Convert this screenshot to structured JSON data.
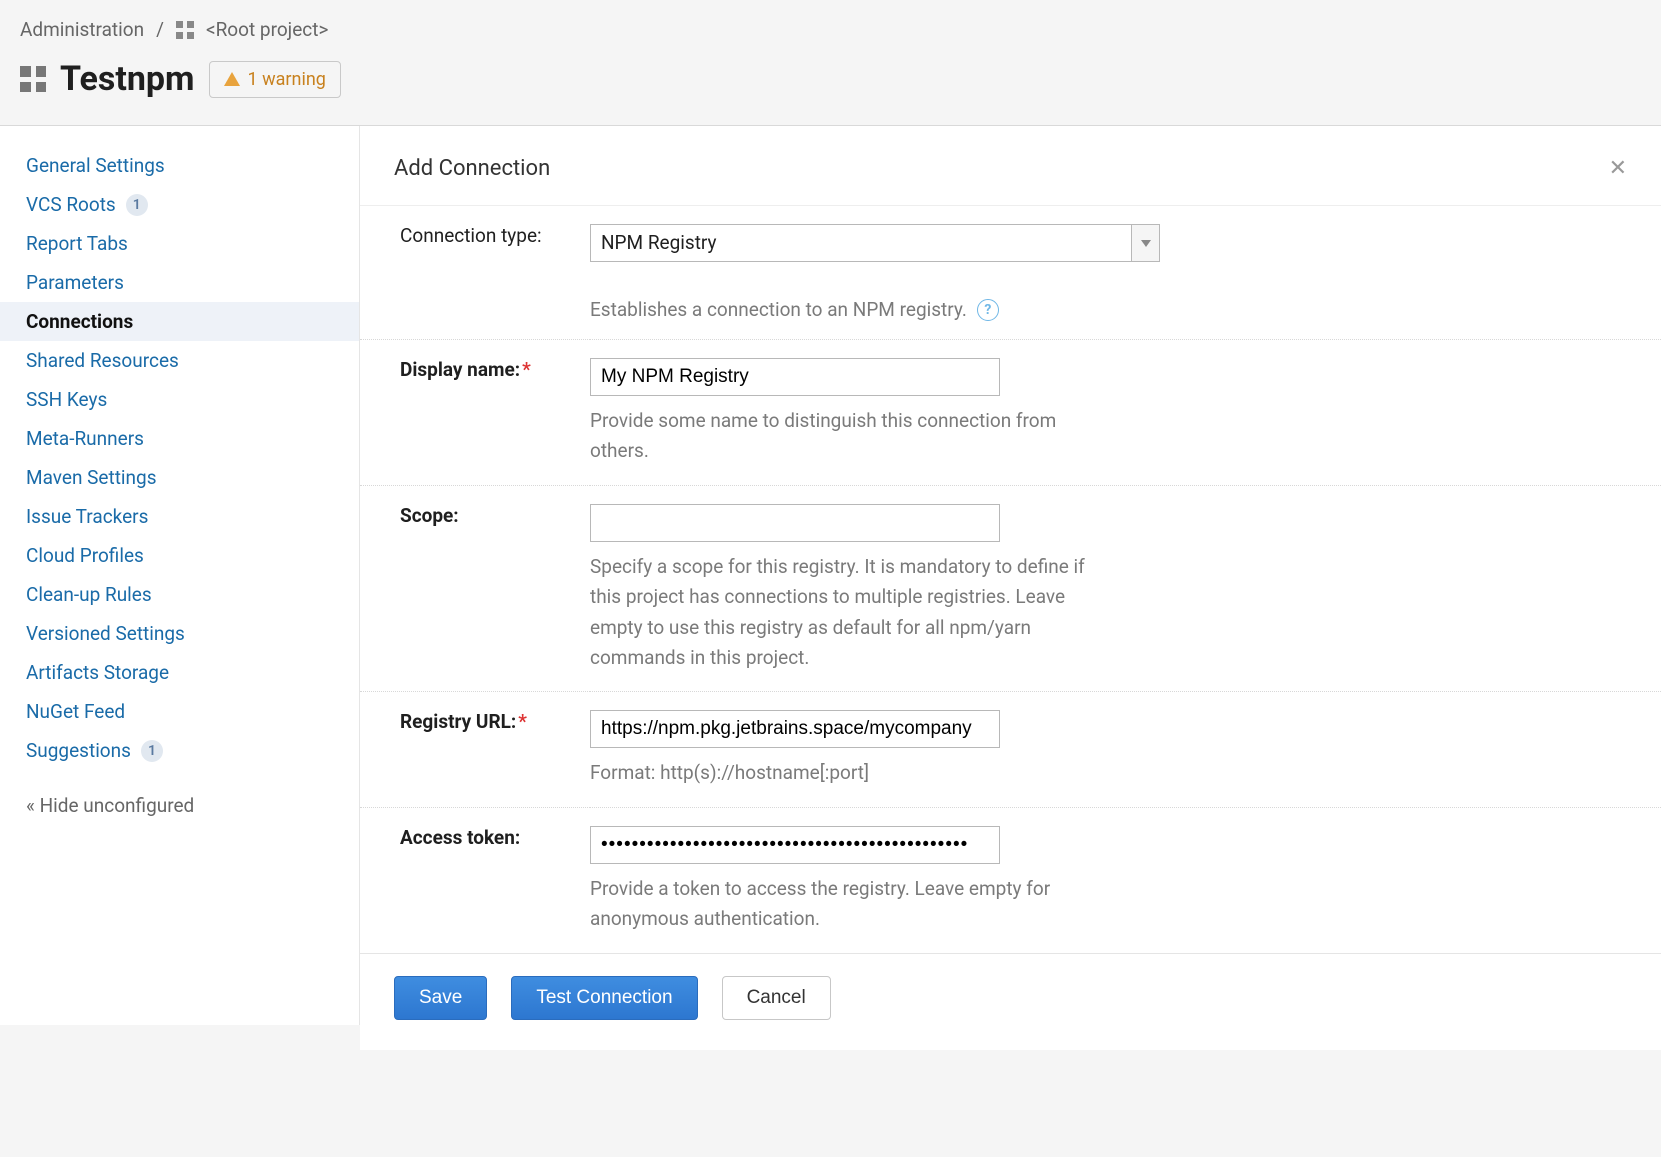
{
  "breadcrumb": {
    "admin": "Administration",
    "sep": "/",
    "root": "<Root project>"
  },
  "header": {
    "title": "Testnpm",
    "warning": "1 warning"
  },
  "sidebar": {
    "items": [
      {
        "label": "General Settings"
      },
      {
        "label": "VCS Roots",
        "badge": "1"
      },
      {
        "label": "Report Tabs"
      },
      {
        "label": "Parameters"
      },
      {
        "label": "Connections",
        "active": true
      },
      {
        "label": "Shared Resources"
      },
      {
        "label": "SSH Keys"
      },
      {
        "label": "Meta-Runners"
      },
      {
        "label": "Maven Settings"
      },
      {
        "label": "Issue Trackers"
      },
      {
        "label": "Cloud Profiles"
      },
      {
        "label": "Clean-up Rules"
      },
      {
        "label": "Versioned Settings"
      },
      {
        "label": "Artifacts Storage"
      },
      {
        "label": "NuGet Feed"
      },
      {
        "label": "Suggestions",
        "badge": "1"
      }
    ],
    "hide": "« Hide unconfigured"
  },
  "panel": {
    "title": "Add Connection",
    "fields": {
      "connection_type": {
        "label": "Connection type:",
        "value": "NPM Registry",
        "desc": "Establishes a connection to an NPM registry."
      },
      "display_name": {
        "label": "Display name:",
        "value": "My NPM Registry",
        "hint": "Provide some name to distinguish this connection from others."
      },
      "scope": {
        "label": "Scope:",
        "value": "",
        "hint": "Specify a scope for this registry. It is mandatory to define if this project has connections to multiple registries. Leave empty to use this registry as default for all npm/yarn commands in this project."
      },
      "registry_url": {
        "label": "Registry URL:",
        "value": "https://npm.pkg.jetbrains.space/mycompany",
        "hint": "Format: http(s)://hostname[:port]"
      },
      "access_token": {
        "label": "Access token:",
        "value": "••••••••••••••••••••••••••••••••••••••••••••••••",
        "hint": "Provide a token to access the registry. Leave empty for anonymous authentication."
      }
    },
    "buttons": {
      "save": "Save",
      "test": "Test Connection",
      "cancel": "Cancel"
    }
  }
}
